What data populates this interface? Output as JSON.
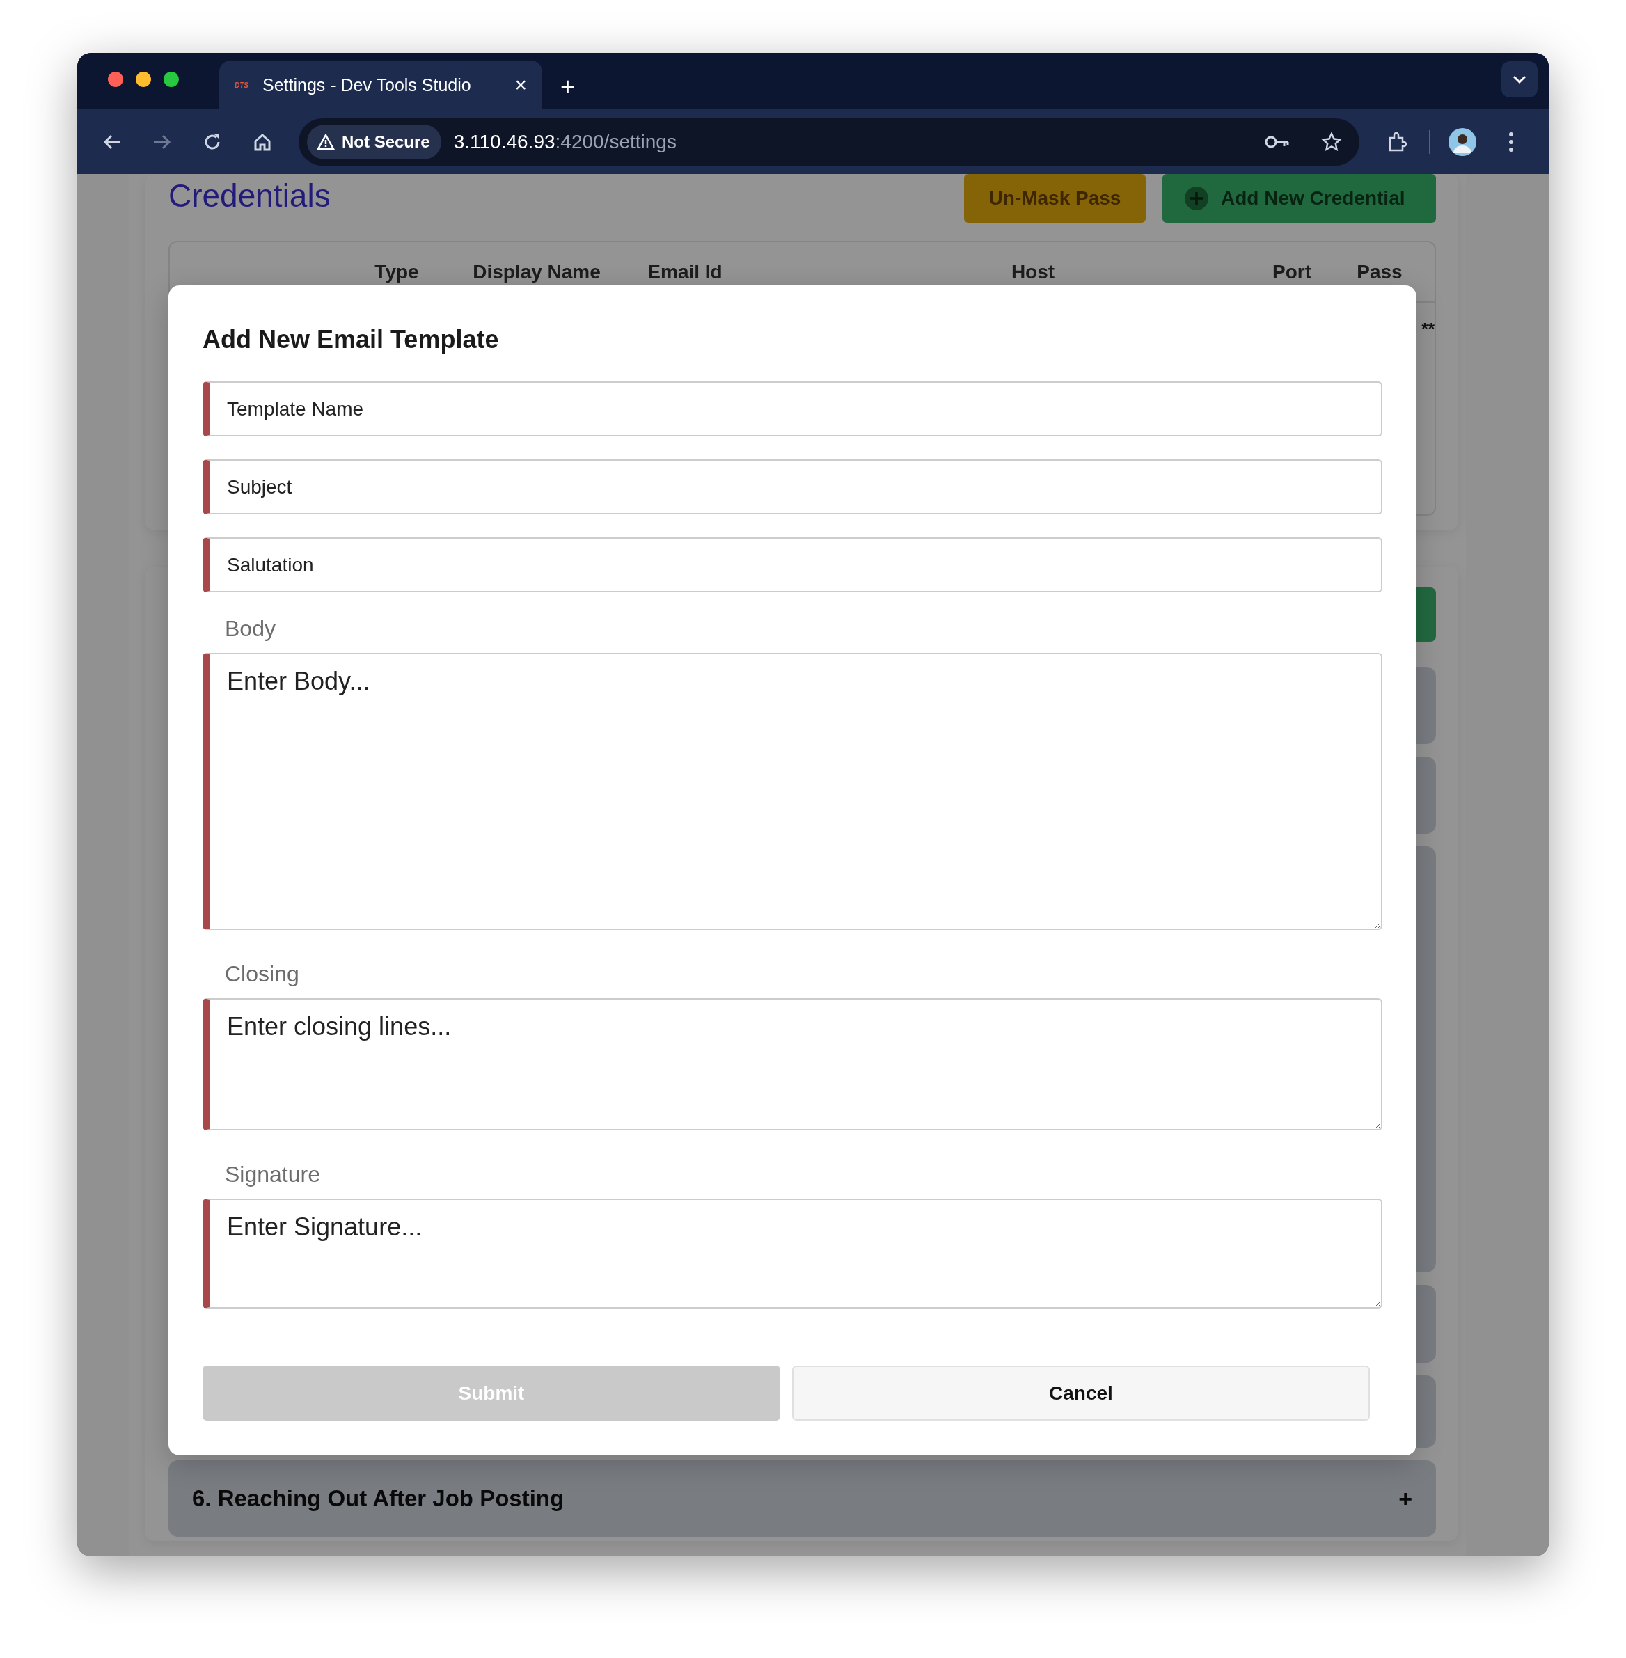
{
  "browser": {
    "tab": {
      "favicon": "DTS",
      "title": "Settings - Dev Tools Studio",
      "close": "×"
    },
    "new_tab": "+",
    "security_chip": "Not Secure",
    "url_host": "3.110.46.93",
    "url_path": ":4200/settings"
  },
  "page": {
    "credentials": {
      "title": "Credentials",
      "buttons": [
        {
          "label": "Un-Mask Pass",
          "kind": "warning"
        },
        {
          "label": "Add New Credential",
          "kind": "add"
        }
      ],
      "table": {
        "columns": [
          "Type",
          "Display Name",
          "Email Id",
          "Host",
          "Port",
          "Pass"
        ],
        "rows": [
          {
            "pass": "**"
          }
        ]
      }
    },
    "templates": {
      "accordion": [
        {
          "title": "6. Reaching Out After Job Posting",
          "toggle": "+"
        }
      ]
    }
  },
  "modal": {
    "title": "Add New Email Template",
    "fields": [
      {
        "kind": "input",
        "placeholder": "Template Name"
      },
      {
        "kind": "input",
        "placeholder": "Subject"
      },
      {
        "kind": "input",
        "placeholder": "Salutation"
      },
      {
        "kind": "textarea",
        "label": "Body",
        "placeholder": "Enter Body..."
      },
      {
        "kind": "textarea",
        "label": "Closing",
        "placeholder": "Enter closing lines..."
      },
      {
        "kind": "textarea",
        "label": "Signature",
        "placeholder": "Enter Signature..."
      }
    ],
    "buttons": [
      {
        "label": "Submit",
        "disabled": true
      },
      {
        "label": "Cancel",
        "disabled": false
      }
    ]
  }
}
